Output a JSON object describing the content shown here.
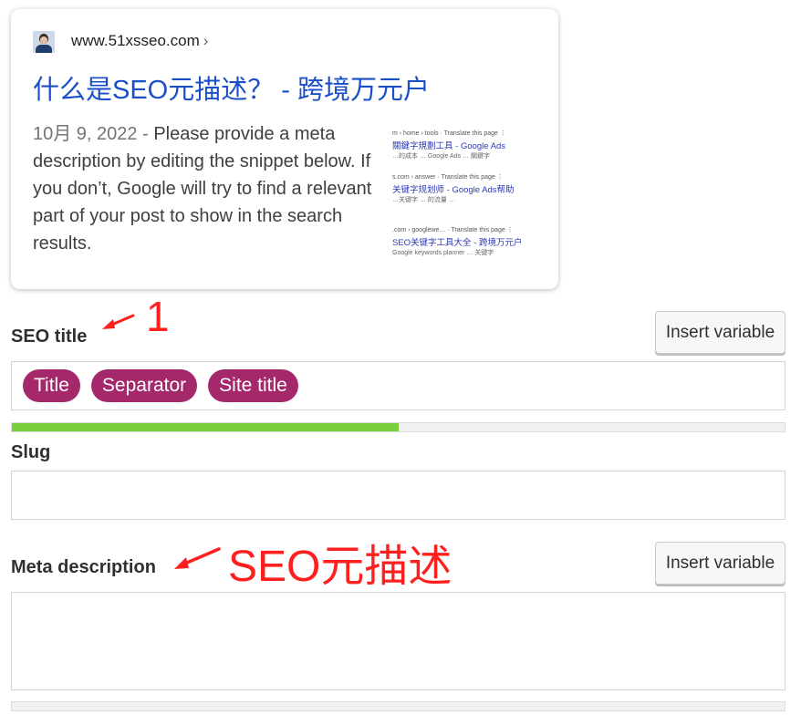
{
  "snippet": {
    "url": "www.51xsseo.com",
    "url_chevron": "›",
    "title": "什么是SEO元描述？ - 跨境万元户",
    "date": "10月 9, 2022",
    "separator": " - ",
    "description": "Please provide a meta description by editing the snippet below. If you don’t, Google will try to find a relevant part of your post to show in the search results.",
    "thumbnail": {
      "results": [
        {
          "url": "m › home › tools · Translate this page  ⋮",
          "title": "關鍵字規劃工具 - Google Ads",
          "desc": "…的成本 … Google Ads … 關鍵字"
        },
        {
          "url": "s.com › answer · Translate this page  ⋮",
          "title": "关键字规划师 - Google Ads帮助",
          "desc": "…关键字 … 的流量 …"
        },
        {
          "url": ".com › googlewe… · Translate this page  ⋮",
          "title": "SEO关键字工具大全 - 跨境万元户",
          "desc": "Google keywords planner … 关键字"
        }
      ]
    }
  },
  "seo_title": {
    "label": "SEO title",
    "insert_button": "Insert variable",
    "chips": [
      "Title",
      "Separator",
      "Site title"
    ],
    "progress": 0.5
  },
  "slug": {
    "label": "Slug",
    "value": ""
  },
  "meta_description": {
    "label": "Meta description",
    "insert_button": "Insert variable",
    "value": "",
    "progress": 0
  },
  "annotations": {
    "one": "1",
    "meta": "SEO元描述"
  },
  "colors": {
    "link_blue": "#1a4fc8",
    "chip": "#a4286a",
    "progress_good": "#7ad03a",
    "annotation_red": "#ff1f1f"
  }
}
